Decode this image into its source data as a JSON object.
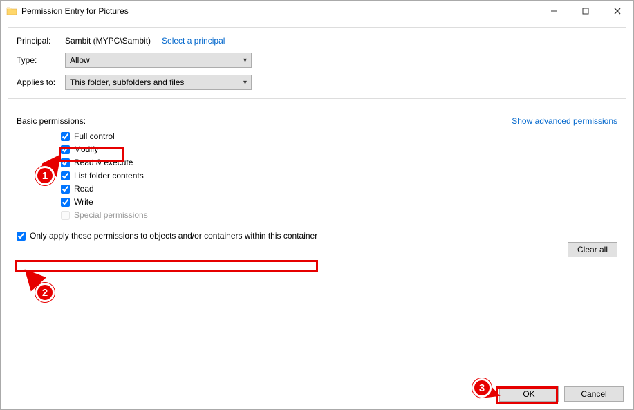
{
  "window": {
    "title": "Permission Entry for Pictures"
  },
  "form": {
    "principal_label": "Principal:",
    "principal_value": "Sambit (MYPC\\Sambit)",
    "select_principal_link": "Select a principal",
    "type_label": "Type:",
    "type_value": "Allow",
    "applies_label": "Applies to:",
    "applies_value": "This folder, subfolders and files"
  },
  "permissions": {
    "heading": "Basic permissions:",
    "advanced_link": "Show advanced permissions",
    "items": [
      {
        "label": "Full control",
        "checked": true,
        "disabled": false
      },
      {
        "label": "Modify",
        "checked": true,
        "disabled": false
      },
      {
        "label": "Read & execute",
        "checked": true,
        "disabled": false
      },
      {
        "label": "List folder contents",
        "checked": true,
        "disabled": false
      },
      {
        "label": "Read",
        "checked": true,
        "disabled": false
      },
      {
        "label": "Write",
        "checked": true,
        "disabled": false
      },
      {
        "label": "Special permissions",
        "checked": false,
        "disabled": true
      }
    ],
    "only_apply_label": "Only apply these permissions to objects and/or containers within this container",
    "only_apply_checked": true,
    "clear_all_label": "Clear all"
  },
  "buttons": {
    "ok": "OK",
    "cancel": "Cancel"
  },
  "annotations": {
    "badge1": "1",
    "badge2": "2",
    "badge3": "3"
  }
}
